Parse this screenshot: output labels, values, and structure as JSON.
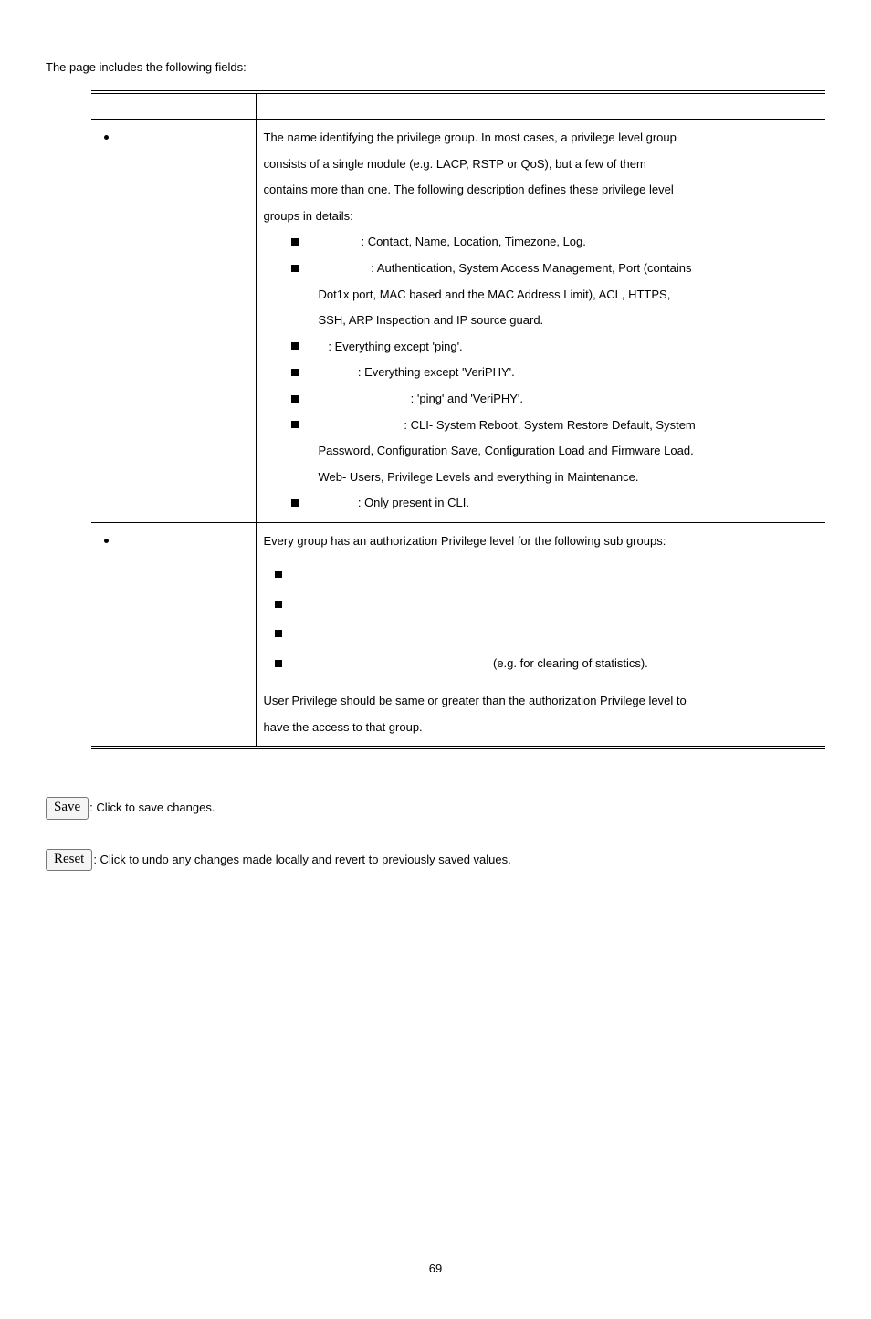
{
  "intro": "The page includes the following fields:",
  "table": {
    "headers": {
      "object": "",
      "description": ""
    },
    "rows": [
      {
        "object": "",
        "description": {
          "intro1": "The name identifying the privilege group. In most cases, a privilege level group",
          "intro2": "consists of a single module (e.g. LACP, RSTP or QoS), but a few of them",
          "intro3": "contains more than one. The following description defines these privilege level",
          "intro4": "groups in details:",
          "items": [
            {
              "text": ": Contact, Name, Location, Timezone, Log."
            },
            {
              "text": ": Authentication, System Access Management, Port (contains",
              "cont": [
                "Dot1x port, MAC based and the MAC Address Limit), ACL, HTTPS,",
                "SSH, ARP Inspection and IP source guard."
              ]
            },
            {
              "text": ": Everything except 'ping'."
            },
            {
              "text": ": Everything except 'VeriPHY'."
            },
            {
              "text": ": 'ping' and 'VeriPHY'."
            },
            {
              "text": ": CLI- System Reboot, System Restore Default, System",
              "cont": [
                "Password, Configuration Save, Configuration Load and Firmware Load.",
                "Web- Users, Privilege Levels and everything in Maintenance."
              ]
            },
            {
              "text": ": Only present in CLI."
            }
          ]
        }
      },
      {
        "object": "",
        "description": {
          "intro1": "Every group has an authorization Privilege level for the following sub groups:",
          "items": [
            {
              "text": ""
            },
            {
              "text": ""
            },
            {
              "text": ""
            },
            {
              "text": "(e.g. for clearing of statistics)."
            }
          ],
          "outro1": "User Privilege should be same or greater than the authorization Privilege level to",
          "outro2": "have the access to that group."
        }
      }
    ]
  },
  "buttons": {
    "save": {
      "label": "Save",
      "desc": ": Click to save changes."
    },
    "reset": {
      "label": "Reset",
      "desc": ": Click to undo any changes made locally and revert to previously saved values."
    }
  },
  "pageNumber": "69"
}
